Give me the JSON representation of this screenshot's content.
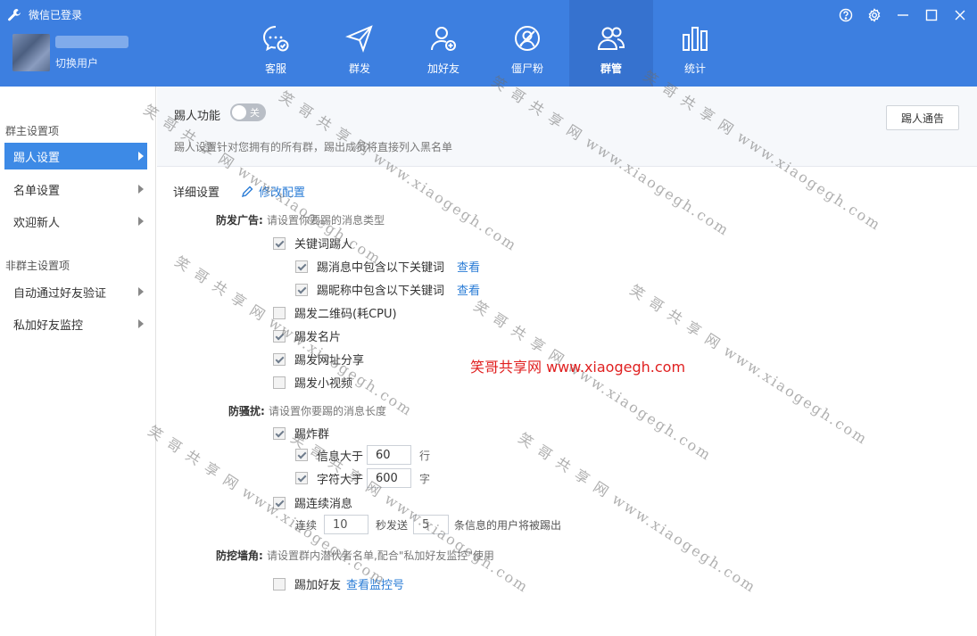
{
  "app": {
    "title": "微信已登录",
    "switch_user": "切换用户"
  },
  "nav": [
    {
      "label": "客服",
      "icon": "chat-icon"
    },
    {
      "label": "群发",
      "icon": "send-icon"
    },
    {
      "label": "加好友",
      "icon": "add-user-icon"
    },
    {
      "label": "僵尸粉",
      "icon": "zombie-fan-icon"
    },
    {
      "label": "群管",
      "icon": "group-manage-icon",
      "active": true
    },
    {
      "label": "统计",
      "icon": "stats-icon"
    }
  ],
  "sidebar": {
    "group1": "群主设置项",
    "items1": [
      "踢人设置",
      "名单设置",
      "欢迎新人"
    ],
    "group2": "非群主设置项",
    "items2": [
      "自动通过好友验证",
      "私加好友监控"
    ]
  },
  "top": {
    "kick_label": "踢人功能",
    "toggle_label": "关",
    "desc": "踢人设置针对您拥有的所有群，踢出成员将直接列入黑名单",
    "notice_button": "踢人通告"
  },
  "detail": {
    "title": "详细设置",
    "edit": "修改配置",
    "ad": {
      "label": "防发广告:",
      "hint": "请设置你要踢的消息类型",
      "keyword_kick": "关键词踢人",
      "msg_keyword": "踢消息中包含以下关键词",
      "nick_keyword": "踢昵称中包含以下关键词",
      "view": "查看",
      "qr": "踢发二维码(耗CPU)",
      "card": "踢发名片",
      "url": "踢发网址分享",
      "video": "踢发小视频"
    },
    "harass": {
      "label": "防骚扰:",
      "hint": "请设置你要踢的消息长度",
      "bomb": "踢炸群",
      "msg_gt": "信息大于",
      "msg_gt_value": "60",
      "msg_unit": "行",
      "char_gt": "字符大于",
      "char_gt_value": "600",
      "char_unit": "字",
      "continuous": "踢连续消息",
      "cont_prefix": "连续",
      "cont_seconds": "10",
      "cont_mid": "秒发送",
      "cont_count": "5",
      "cont_suffix": "条信息的用户将被踢出"
    },
    "poach": {
      "label": "防挖墙角:",
      "hint": "请设置群内潜伏者名单,配合\"私加好友监控\"使用",
      "add_friend": "踢加好友",
      "view_monitor": "查看监控号"
    }
  },
  "watermark": {
    "center": "笑哥共享网 www.xiaogegh.com",
    "diag": "笑 哥 共 享 网   www.xiaogegh.com"
  }
}
